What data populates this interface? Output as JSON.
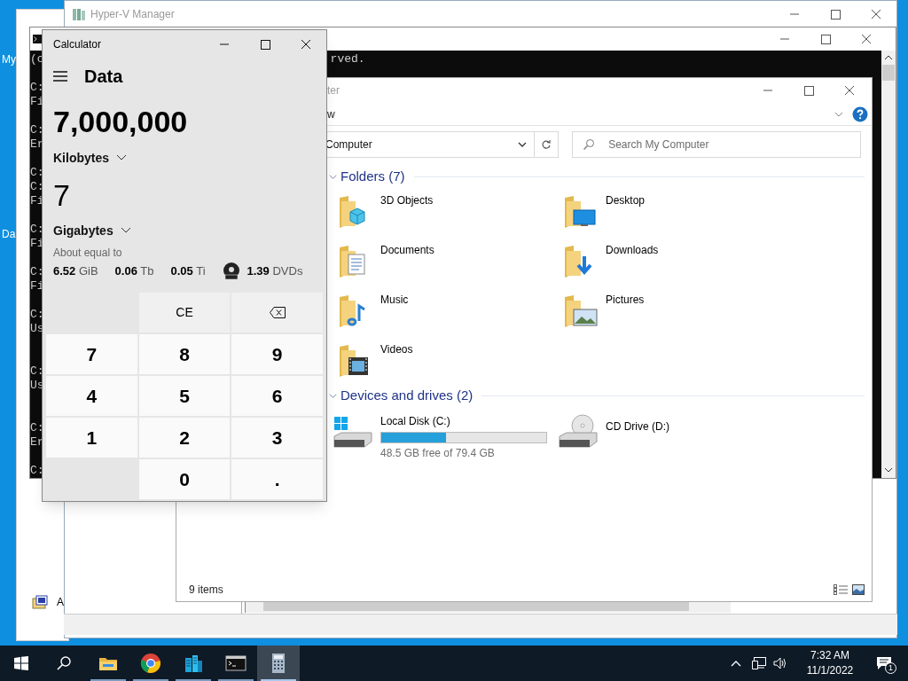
{
  "desktop": {
    "icon_labels": [
      "My",
      "Da"
    ]
  },
  "back_window": {
    "item_label": "A"
  },
  "hyperv": {
    "title": "Hyper-V Manager"
  },
  "cmd": {
    "first_left": "(c",
    "first_right": "rved.",
    "blocks": [
      [
        "C:",
        "Fi"
      ],
      [
        "C:",
        "Er"
      ],
      [
        "C:",
        "C:",
        "Fi"
      ],
      [
        "C:",
        "Fi"
      ],
      [
        "C:",
        "Fi"
      ],
      [
        "C:",
        "Us"
      ],
      [
        "C:",
        "Us"
      ],
      [
        "C:",
        "Er"
      ],
      [
        "C:"
      ]
    ]
  },
  "explorer": {
    "title": "ter",
    "ribbon_tab": "w",
    "address": "Computer",
    "search": {
      "placeholder": "Search My Computer"
    },
    "groups": [
      {
        "title": "Folders (7)",
        "items": [
          {
            "kind": "objects",
            "label": "3D Objects"
          },
          {
            "kind": "desktop",
            "label": "Desktop"
          },
          {
            "kind": "documents",
            "label": "Documents"
          },
          {
            "kind": "downloads",
            "label": "Downloads"
          },
          {
            "kind": "music",
            "label": "Music"
          },
          {
            "kind": "pictures",
            "label": "Pictures"
          },
          {
            "kind": "videos",
            "label": "Videos"
          }
        ]
      },
      {
        "title": "Devices and drives (2)",
        "items": [
          {
            "kind": "disk",
            "label": "Local Disk (C:)",
            "level": 0.39,
            "free": "48.5 GB free of 79.4 GB"
          },
          {
            "kind": "cd",
            "label": "CD Drive (D:)"
          }
        ]
      }
    ],
    "status": "9 items"
  },
  "calculator": {
    "title": "Calculator",
    "mode": "Data",
    "input_value": "7,000,000",
    "input_unit": "Kilobytes",
    "output_value": "7",
    "output_unit": "Gigabytes",
    "about": "About equal to",
    "equivalents": [
      {
        "kind": "plain",
        "text": "**6.52** GiB"
      },
      {
        "kind": "plain",
        "text": "**0.06** Tb"
      },
      {
        "kind": "plain",
        "text": "**0.05** Ti"
      },
      {
        "kind": "disc",
        "text": "**1.39** DVDs"
      }
    ],
    "keys": [
      {
        "kind": "blank"
      },
      {
        "kind": "action",
        "label": "CE"
      },
      {
        "kind": "backspace"
      },
      {
        "kind": "digit",
        "label": "7"
      },
      {
        "kind": "digit",
        "label": "8"
      },
      {
        "kind": "digit",
        "label": "9"
      },
      {
        "kind": "digit",
        "label": "4"
      },
      {
        "kind": "digit",
        "label": "5"
      },
      {
        "kind": "digit",
        "label": "6"
      },
      {
        "kind": "digit",
        "label": "1"
      },
      {
        "kind": "digit",
        "label": "2"
      },
      {
        "kind": "digit",
        "label": "3"
      },
      {
        "kind": "blank"
      },
      {
        "kind": "digit",
        "label": "0"
      },
      {
        "kind": "digit",
        "label": "."
      }
    ]
  },
  "taskbar": {
    "apps": [
      {
        "kind": "files",
        "selected": false
      },
      {
        "kind": "browser",
        "selected": false
      },
      {
        "kind": "server",
        "selected": false
      },
      {
        "kind": "terminal",
        "selected": false
      },
      {
        "kind": "calculator",
        "selected": true
      }
    ],
    "time": "7:32 AM",
    "date": "11/1/2022",
    "notification_count": "1"
  }
}
